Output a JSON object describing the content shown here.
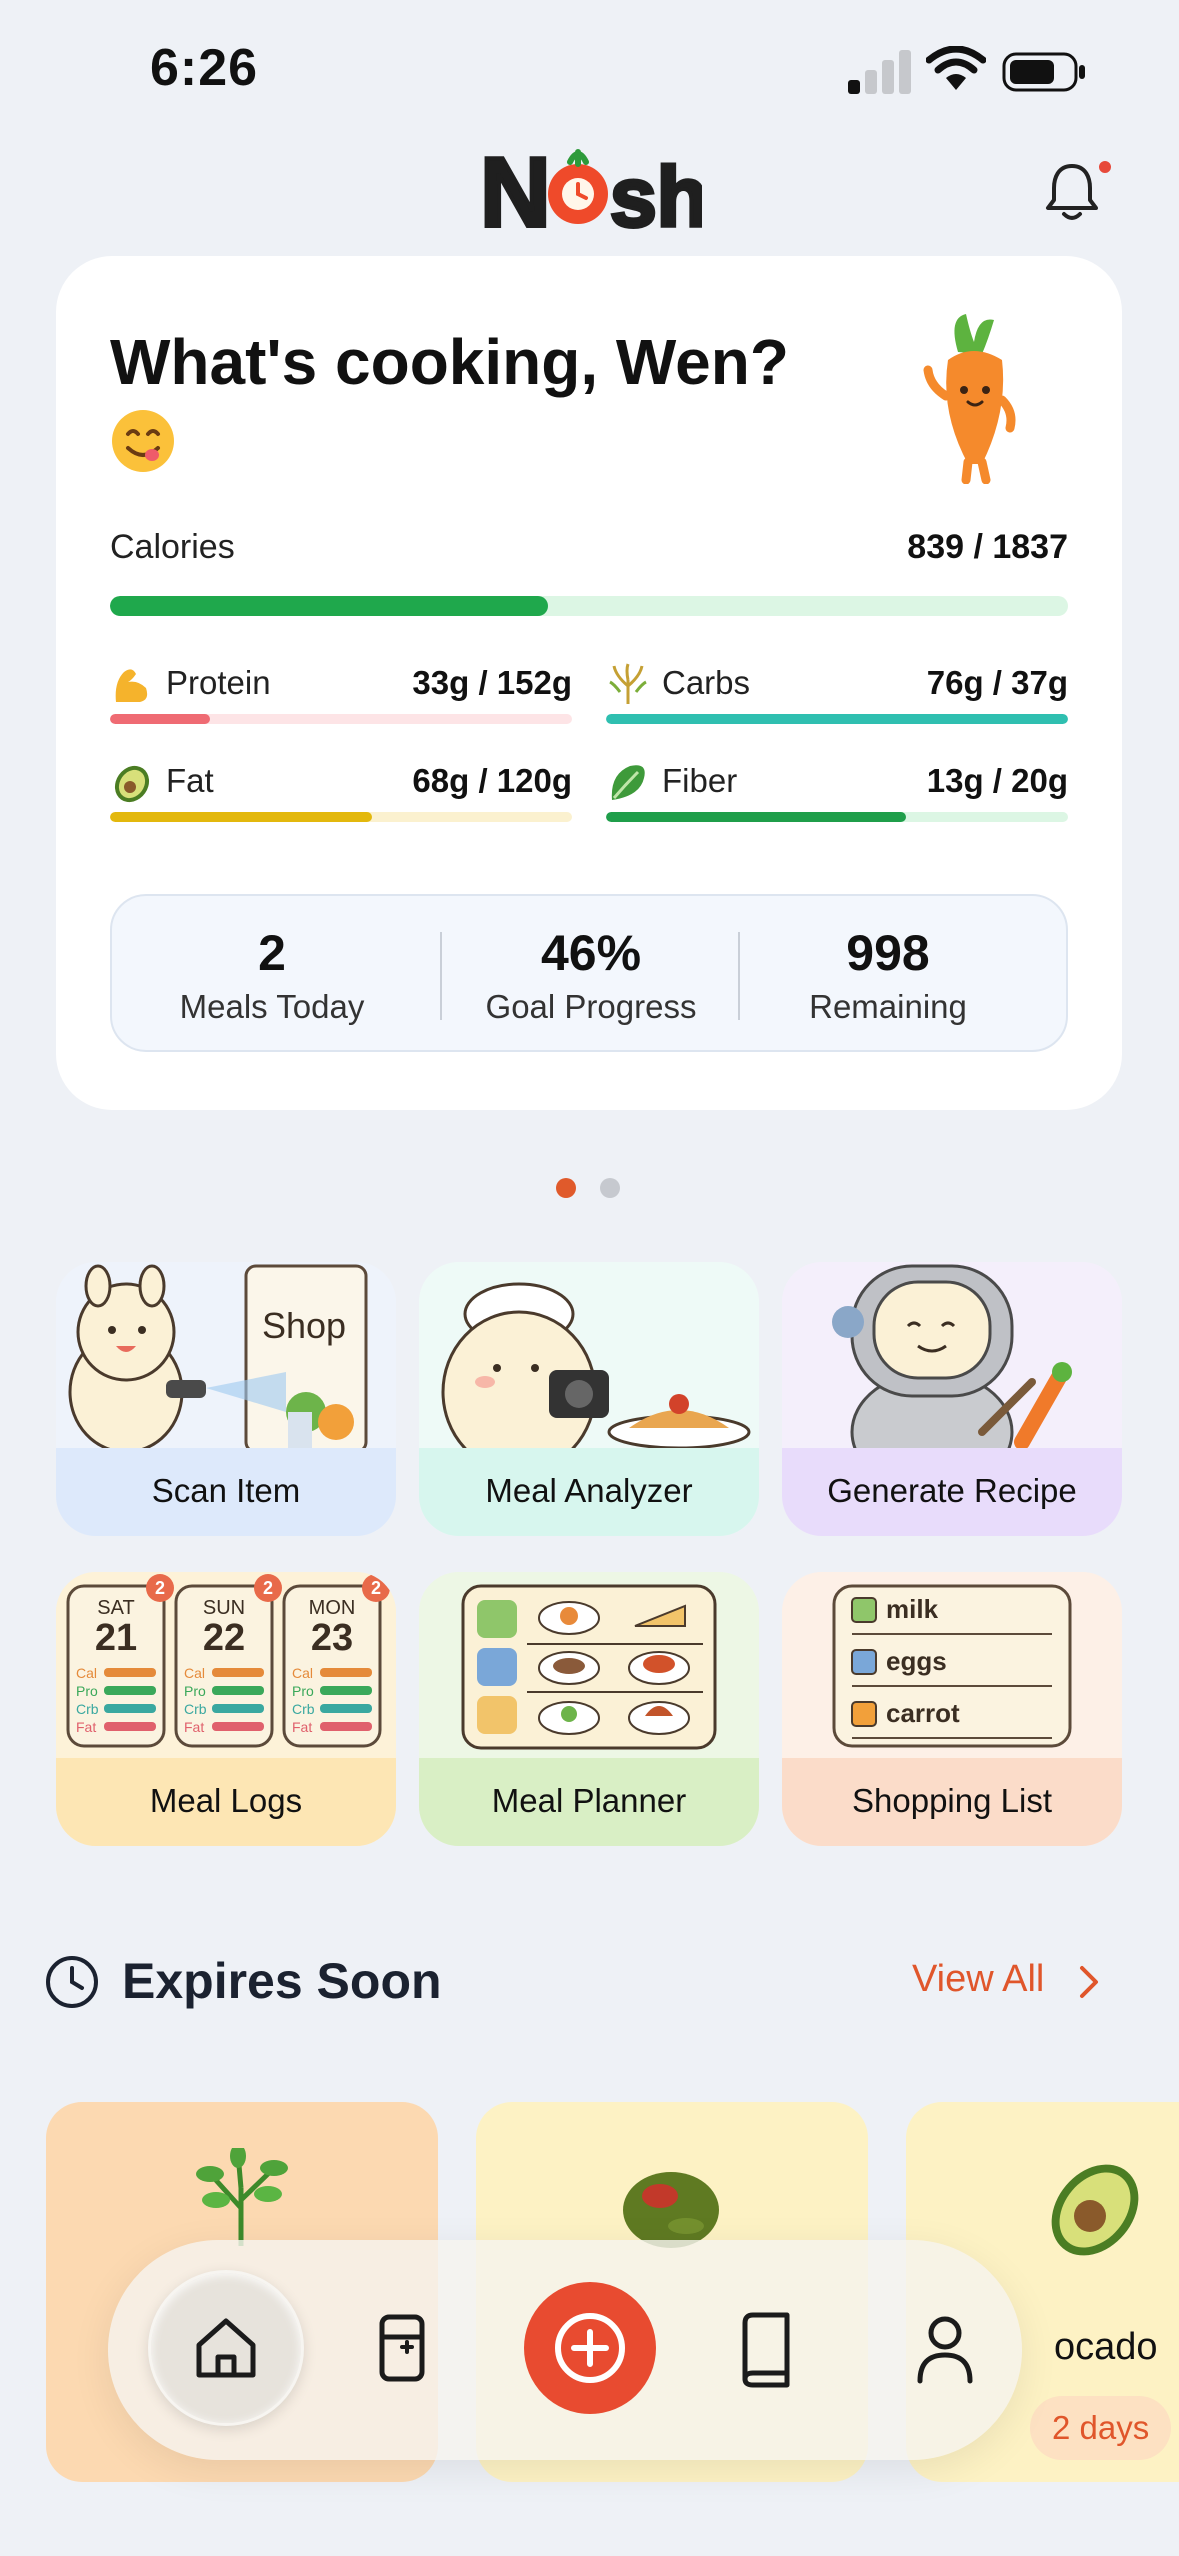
{
  "status_bar": {
    "time": "6:26"
  },
  "header": {
    "logo_text": "Nosh"
  },
  "summary": {
    "greeting": "What's cooking, Wen?",
    "calories": {
      "label": "Calories",
      "value_text": "839 / 1837",
      "current": 839,
      "goal": 1837
    },
    "macros": [
      {
        "label": "Protein",
        "value_text": "33g / 152g",
        "current": 33,
        "goal": 152,
        "color": "#ef6b73",
        "track": "#fde4e6",
        "icon": "flexed-bicep-icon"
      },
      {
        "label": "Carbs",
        "value_text": "76g / 37g",
        "current": 76,
        "goal": 37,
        "color": "#2fbfb0",
        "track": "#d6f5f1",
        "icon": "rice-stalk-icon"
      },
      {
        "label": "Fat",
        "value_text": "68g / 120g",
        "current": 68,
        "goal": 120,
        "color": "#e3b80d",
        "track": "#fbf1cf",
        "icon": "avocado-icon"
      },
      {
        "label": "Fiber",
        "value_text": "13g / 20g",
        "current": 13,
        "goal": 20,
        "color": "#1f9e4a",
        "track": "#dcf6e4",
        "icon": "leafy-green-icon"
      }
    ],
    "stats": [
      {
        "value": "2",
        "label": "Meals Today"
      },
      {
        "value": "46%",
        "label": "Goal Progress"
      },
      {
        "value": "998",
        "label": "Remaining"
      }
    ]
  },
  "carousel": {
    "pages": 2,
    "active": 0
  },
  "features": [
    {
      "label": "Scan Item",
      "band_color": "#dde9fb",
      "art_color": "#eef3fb"
    },
    {
      "label": "Meal Analyzer",
      "band_color": "#d7f6ee",
      "art_color": "#eefaf7"
    },
    {
      "label": "Generate Recipe",
      "band_color": "#e8dcfb",
      "art_color": "#f4effb"
    },
    {
      "label": "Meal Logs",
      "band_color": "#fde6b4",
      "art_color": "#fdf2d8"
    },
    {
      "label": "Meal Planner",
      "band_color": "#d9efc5",
      "art_color": "#edf7e5"
    },
    {
      "label": "Shopping List",
      "band_color": "#fbdcc9",
      "art_color": "#fdf0e7"
    }
  ],
  "meal_logs_art": {
    "days": [
      {
        "day": "SAT",
        "date": "21",
        "badge": "2"
      },
      {
        "day": "SUN",
        "date": "22",
        "badge": "2"
      },
      {
        "day": "MON",
        "date": "23",
        "badge": "2"
      }
    ],
    "rows": [
      "Cal",
      "Pro",
      "Crb",
      "Fat"
    ]
  },
  "scan_art": {
    "sign": "Shop"
  },
  "shopping_art": {
    "items": [
      "milk",
      "eggs",
      "carrot"
    ]
  },
  "expires": {
    "title": "Expires Soon",
    "view_all": "View All",
    "items": [
      {
        "name": "",
        "days": "",
        "bg": "#fcd9b1"
      },
      {
        "name": "",
        "days": "",
        "bg": "#fdf2c4"
      },
      {
        "name": "ocado",
        "days": "2 days",
        "bg": "#fdf2c4"
      }
    ]
  },
  "nav": {
    "items": [
      "home-icon",
      "fridge-icon",
      "add-icon",
      "book-icon",
      "profile-icon"
    ],
    "active": "home-icon"
  }
}
